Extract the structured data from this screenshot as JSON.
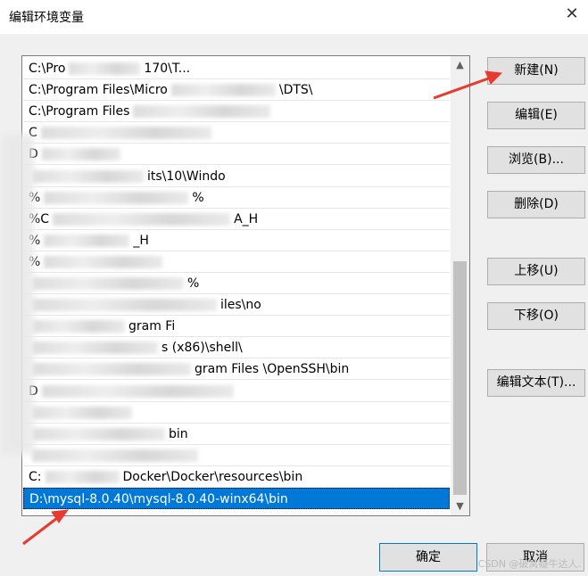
{
  "window": {
    "title": "编辑环境变量",
    "close_glyph": "✕"
  },
  "list": {
    "items": [
      {
        "text": "C:\\Pro",
        "tail": "170\\T..."
      },
      {
        "text": "C:\\Program Files\\Micro",
        "tail": "\\DTS\\"
      },
      {
        "text": "C:\\Program Files",
        "tail": ""
      },
      {
        "text": "C",
        "tail": ""
      },
      {
        "text": "D",
        "tail": ""
      },
      {
        "text": "",
        "tail": "its\\10\\Windo"
      },
      {
        "text": "%",
        "tail": "%"
      },
      {
        "text": "%C",
        "tail": "A_H"
      },
      {
        "text": "%",
        "tail": "_H"
      },
      {
        "text": "%",
        "tail": ""
      },
      {
        "text": "",
        "tail": "%"
      },
      {
        "text": "",
        "tail": "iles\\no"
      },
      {
        "text": "",
        "tail": "gram Fi"
      },
      {
        "text": "",
        "tail": "s (x86)\\shell\\"
      },
      {
        "text": "",
        "tail": "gram Files \\OpenSSH\\bin"
      },
      {
        "text": "D",
        "tail": ""
      },
      {
        "text": "",
        "tail": ""
      },
      {
        "text": "",
        "tail": "bin"
      },
      {
        "text": "",
        "tail": ""
      },
      {
        "text": "C:",
        "tail": "Docker\\Docker\\resources\\bin"
      },
      {
        "text": "D:\\mysql-8.0.40\\mysql-8.0.40-winx64\\bin",
        "tail": "",
        "selected": true
      }
    ],
    "scroll_up_glyph": "▲",
    "scroll_down_glyph": "▼"
  },
  "buttons": {
    "new": "新建(N)",
    "edit": "编辑(E)",
    "browse": "浏览(B)...",
    "delete": "删除(D)",
    "move_up": "上移(U)",
    "move_down": "下移(O)",
    "edit_text": "编辑文本(T)...",
    "ok": "确定",
    "cancel": "取消"
  },
  "watermark": "CSDN @破窝疑牛达人."
}
